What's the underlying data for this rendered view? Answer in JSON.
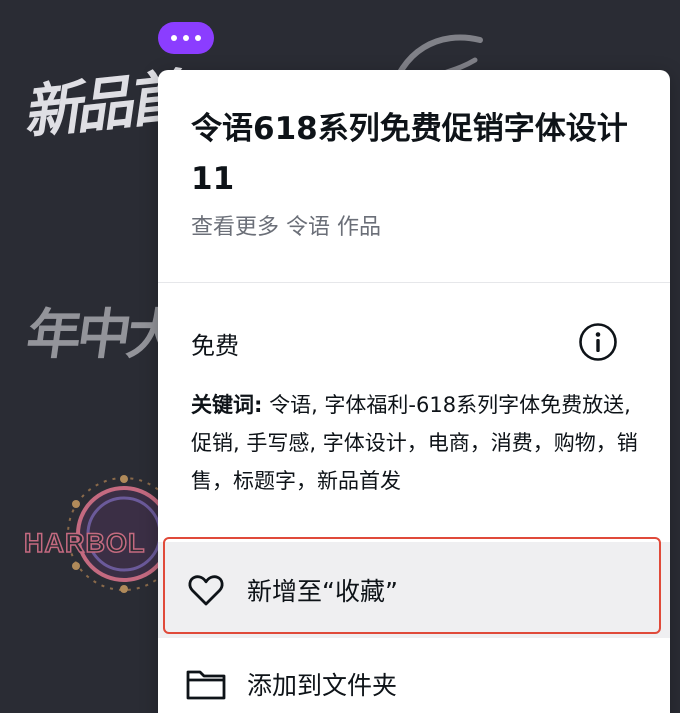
{
  "background": {
    "art_text_1": "新品首",
    "art_text_2": "年中大促",
    "badge_text": "HARBOL",
    "art_text_bottom": "ー"
  },
  "more_button": {
    "icon": "ellipsis-icon",
    "color": "#8b3dff"
  },
  "card": {
    "title": "令语618系列免费促销字体设计11",
    "subtitle": "查看更多 令语 作品",
    "price_label": "免费",
    "info_icon": "info-icon",
    "keywords_label": "关键词:",
    "keywords_text": " 令语, 字体福利-618系列字体免费放送, 促销, 手写感, 字体设计，电商，消费，购物，销售，标题字，新品首发"
  },
  "menu": {
    "favorite": {
      "label": "新增至“收藏”",
      "icon": "heart-icon"
    },
    "folder": {
      "label": "添加到文件夹",
      "icon": "folder-icon"
    }
  },
  "colors": {
    "highlight": "#e04a3a",
    "accent": "#8b3dff",
    "background": "#2a2c34"
  }
}
